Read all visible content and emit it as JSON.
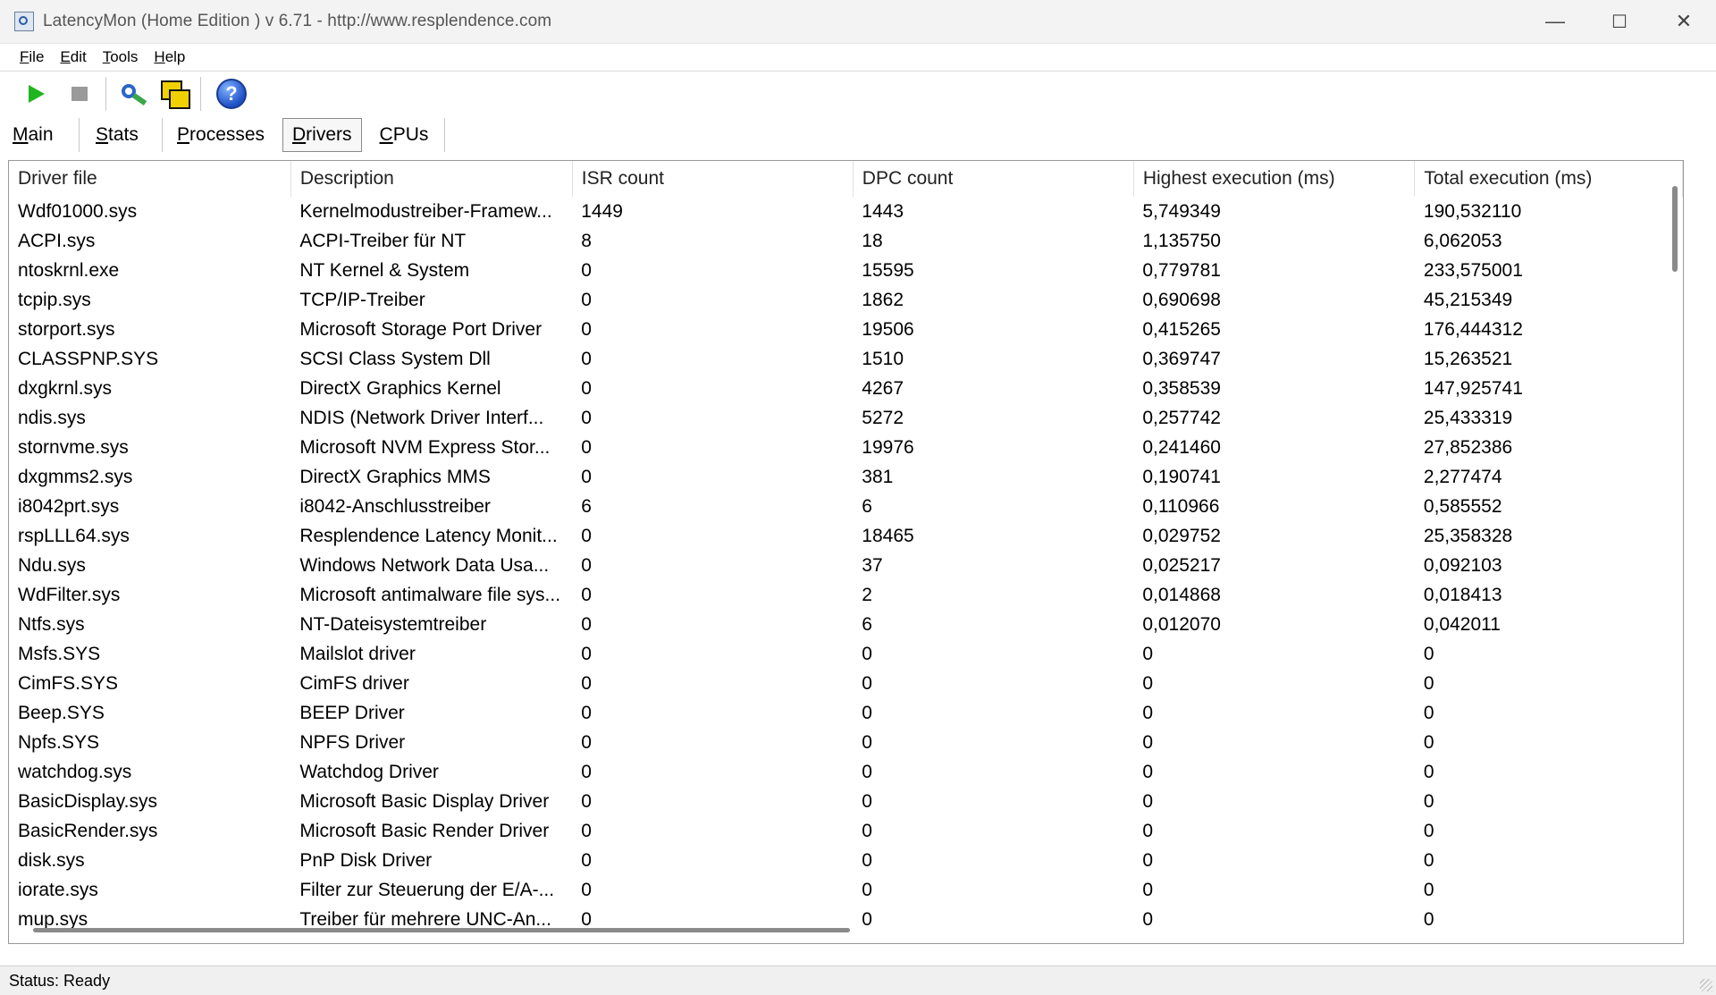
{
  "window": {
    "title": "LatencyMon  (Home Edition )  v 6.71 - http://www.resplendence.com",
    "minimize": "—",
    "maximize": "☐",
    "close": "✕"
  },
  "menu": [
    {
      "label": "File",
      "key": "F",
      "rest": "ile"
    },
    {
      "label": "Edit",
      "key": "E",
      "rest": "dit"
    },
    {
      "label": "Tools",
      "key": "T",
      "rest": "ools"
    },
    {
      "label": "Help",
      "key": "H",
      "rest": "elp"
    }
  ],
  "toolbar": {
    "start_icon": "play-icon",
    "stop_icon": "stop-icon",
    "scan_icon": "scan-icon",
    "windows_icon": "windows-icon",
    "help_icon": "help-icon",
    "help_glyph": "?"
  },
  "tabs": [
    {
      "label": "Main",
      "key": "M",
      "rest": "ain",
      "active": false
    },
    {
      "label": "Stats",
      "key": "S",
      "rest": "tats",
      "active": false
    },
    {
      "label": "Processes",
      "key": "P",
      "rest": "rocesses",
      "active": false
    },
    {
      "label": "Drivers",
      "key": "D",
      "rest": "rivers",
      "active": true
    },
    {
      "label": "CPUs",
      "key": "C",
      "rest": "PUs",
      "active": false
    }
  ],
  "table": {
    "columns": [
      "Driver file",
      "Description",
      "ISR count",
      "DPC count",
      "Highest execution (ms)",
      "Total execution (ms)"
    ],
    "rows": [
      [
        "Wdf01000.sys",
        "Kernelmodustreiber-Framew...",
        "1449",
        "1443",
        "5,749349",
        "190,532110"
      ],
      [
        "ACPI.sys",
        "ACPI-Treiber für NT",
        "8",
        "18",
        "1,135750",
        "6,062053"
      ],
      [
        "ntoskrnl.exe",
        "NT Kernel & System",
        "0",
        "15595",
        "0,779781",
        "233,575001"
      ],
      [
        "tcpip.sys",
        "TCP/IP-Treiber",
        "0",
        "1862",
        "0,690698",
        "45,215349"
      ],
      [
        "storport.sys",
        "Microsoft Storage Port Driver",
        "0",
        "19506",
        "0,415265",
        "176,444312"
      ],
      [
        "CLASSPNP.SYS",
        "SCSI Class System Dll",
        "0",
        "1510",
        "0,369747",
        "15,263521"
      ],
      [
        "dxgkrnl.sys",
        "DirectX Graphics Kernel",
        "0",
        "4267",
        "0,358539",
        "147,925741"
      ],
      [
        "ndis.sys",
        "NDIS (Network Driver Interf...",
        "0",
        "5272",
        "0,257742",
        "25,433319"
      ],
      [
        "stornvme.sys",
        "Microsoft NVM Express Stor...",
        "0",
        "19976",
        "0,241460",
        "27,852386"
      ],
      [
        "dxgmms2.sys",
        "DirectX Graphics MMS",
        "0",
        "381",
        "0,190741",
        "2,277474"
      ],
      [
        "i8042prt.sys",
        "i8042-Anschlusstreiber",
        "6",
        "6",
        "0,110966",
        "0,585552"
      ],
      [
        "rspLLL64.sys",
        "Resplendence Latency Monit...",
        "0",
        "18465",
        "0,029752",
        "25,358328"
      ],
      [
        "Ndu.sys",
        "Windows Network Data Usa...",
        "0",
        "37",
        "0,025217",
        "0,092103"
      ],
      [
        "WdFilter.sys",
        "Microsoft antimalware file sys...",
        "0",
        "2",
        "0,014868",
        "0,018413"
      ],
      [
        "Ntfs.sys",
        "NT-Dateisystemtreiber",
        "0",
        "6",
        "0,012070",
        "0,042011"
      ],
      [
        "Msfs.SYS",
        "Mailslot driver",
        "0",
        "0",
        "0",
        "0"
      ],
      [
        "CimFS.SYS",
        "CimFS driver",
        "0",
        "0",
        "0",
        "0"
      ],
      [
        "Beep.SYS",
        "BEEP Driver",
        "0",
        "0",
        "0",
        "0"
      ],
      [
        "Npfs.SYS",
        "NPFS Driver",
        "0",
        "0",
        "0",
        "0"
      ],
      [
        "watchdog.sys",
        "Watchdog Driver",
        "0",
        "0",
        "0",
        "0"
      ],
      [
        "BasicDisplay.sys",
        "Microsoft Basic Display Driver",
        "0",
        "0",
        "0",
        "0"
      ],
      [
        "BasicRender.sys",
        "Microsoft Basic Render Driver",
        "0",
        "0",
        "0",
        "0"
      ],
      [
        "disk.sys",
        "PnP Disk Driver",
        "0",
        "0",
        "0",
        "0"
      ],
      [
        "iorate.sys",
        "Filter zur Steuerung der E/A-...",
        "0",
        "0",
        "0",
        "0"
      ],
      [
        "mup.sys",
        "Treiber für mehrere UNC-An...",
        "0",
        "0",
        "0",
        "0"
      ]
    ]
  },
  "status": {
    "text": "Status: Ready"
  }
}
